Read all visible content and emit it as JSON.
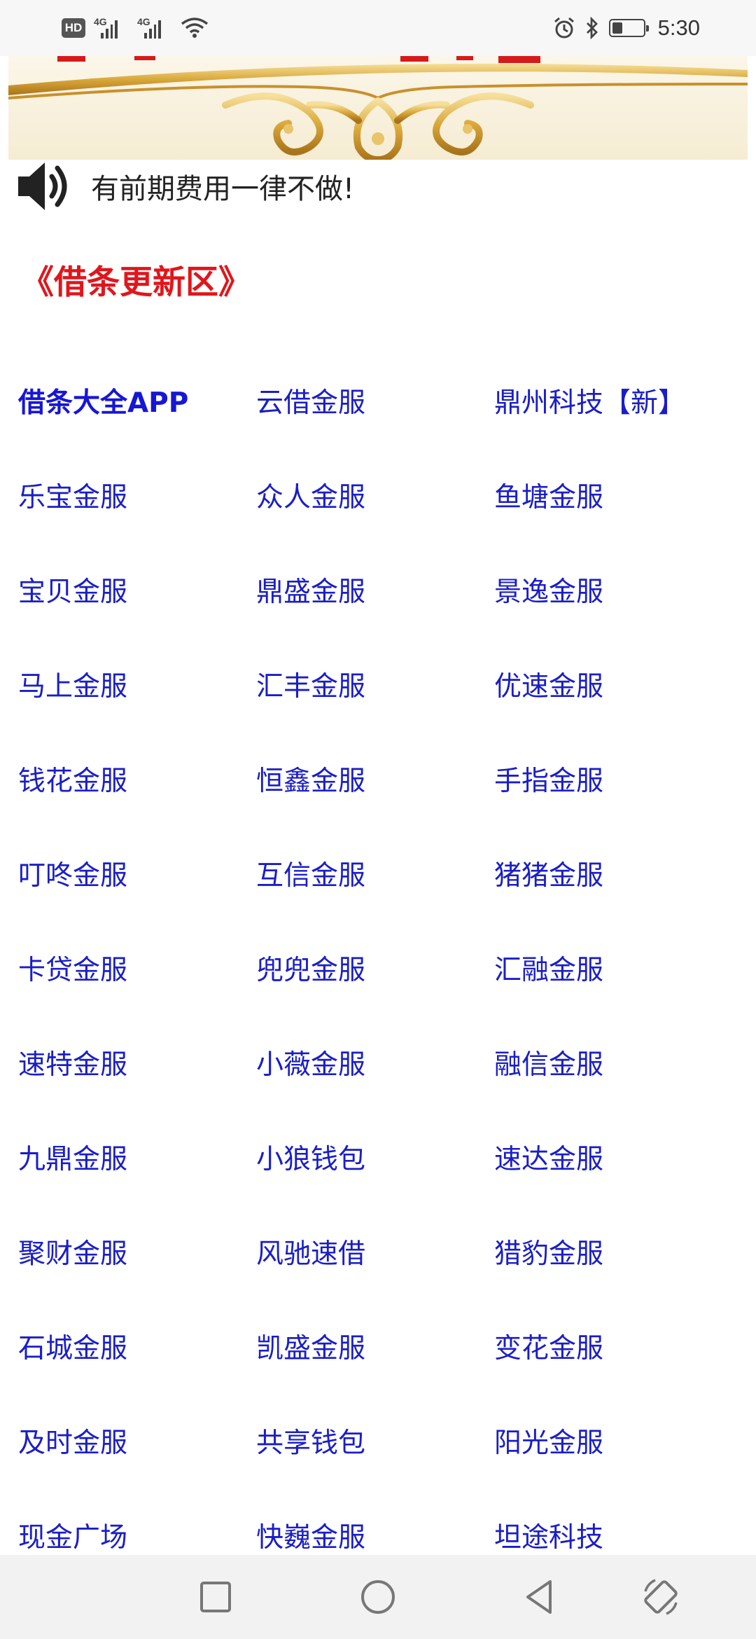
{
  "status_bar": {
    "hd_label": "HD",
    "signal_1_label": "4G",
    "signal_2_label": "4G",
    "time": "5:30"
  },
  "notice": {
    "text": "有前期费用一律不做!"
  },
  "section": {
    "title": "《借条更新区》"
  },
  "links": [
    [
      "借条大全APP",
      "云借金服",
      "鼎州科技【新】"
    ],
    [
      "乐宝金服",
      "众人金服",
      "鱼塘金服"
    ],
    [
      "宝贝金服",
      "鼎盛金服",
      "景逸金服"
    ],
    [
      "马上金服",
      "汇丰金服",
      "优速金服"
    ],
    [
      "钱花金服",
      "恒鑫金服",
      "手指金服"
    ],
    [
      "叮咚金服",
      "互信金服",
      "猪猪金服"
    ],
    [
      "卡贷金服",
      "兜兜金服",
      "汇融金服"
    ],
    [
      "速特金服",
      "小薇金服",
      "融信金服"
    ],
    [
      "九鼎金服",
      "小狼钱包",
      "速达金服"
    ],
    [
      "聚财金服",
      "风驰速借",
      "猎豹金服"
    ],
    [
      "石城金服",
      "凯盛金服",
      "变花金服"
    ],
    [
      "及时金服",
      "共享钱包",
      "阳光金服"
    ],
    [
      "现金广场",
      "快巍金服",
      "坦途科技"
    ]
  ],
  "colors": {
    "link": "#1a1ec6",
    "title": "#e0161c",
    "banner_gold": "#d9a83a",
    "nav_bg": "#f2f2f2"
  },
  "icons": {
    "notice": "speaker-icon",
    "nav": [
      "square-recents-icon",
      "circle-home-icon",
      "triangle-back-icon",
      "rotate-screen-icon"
    ]
  }
}
